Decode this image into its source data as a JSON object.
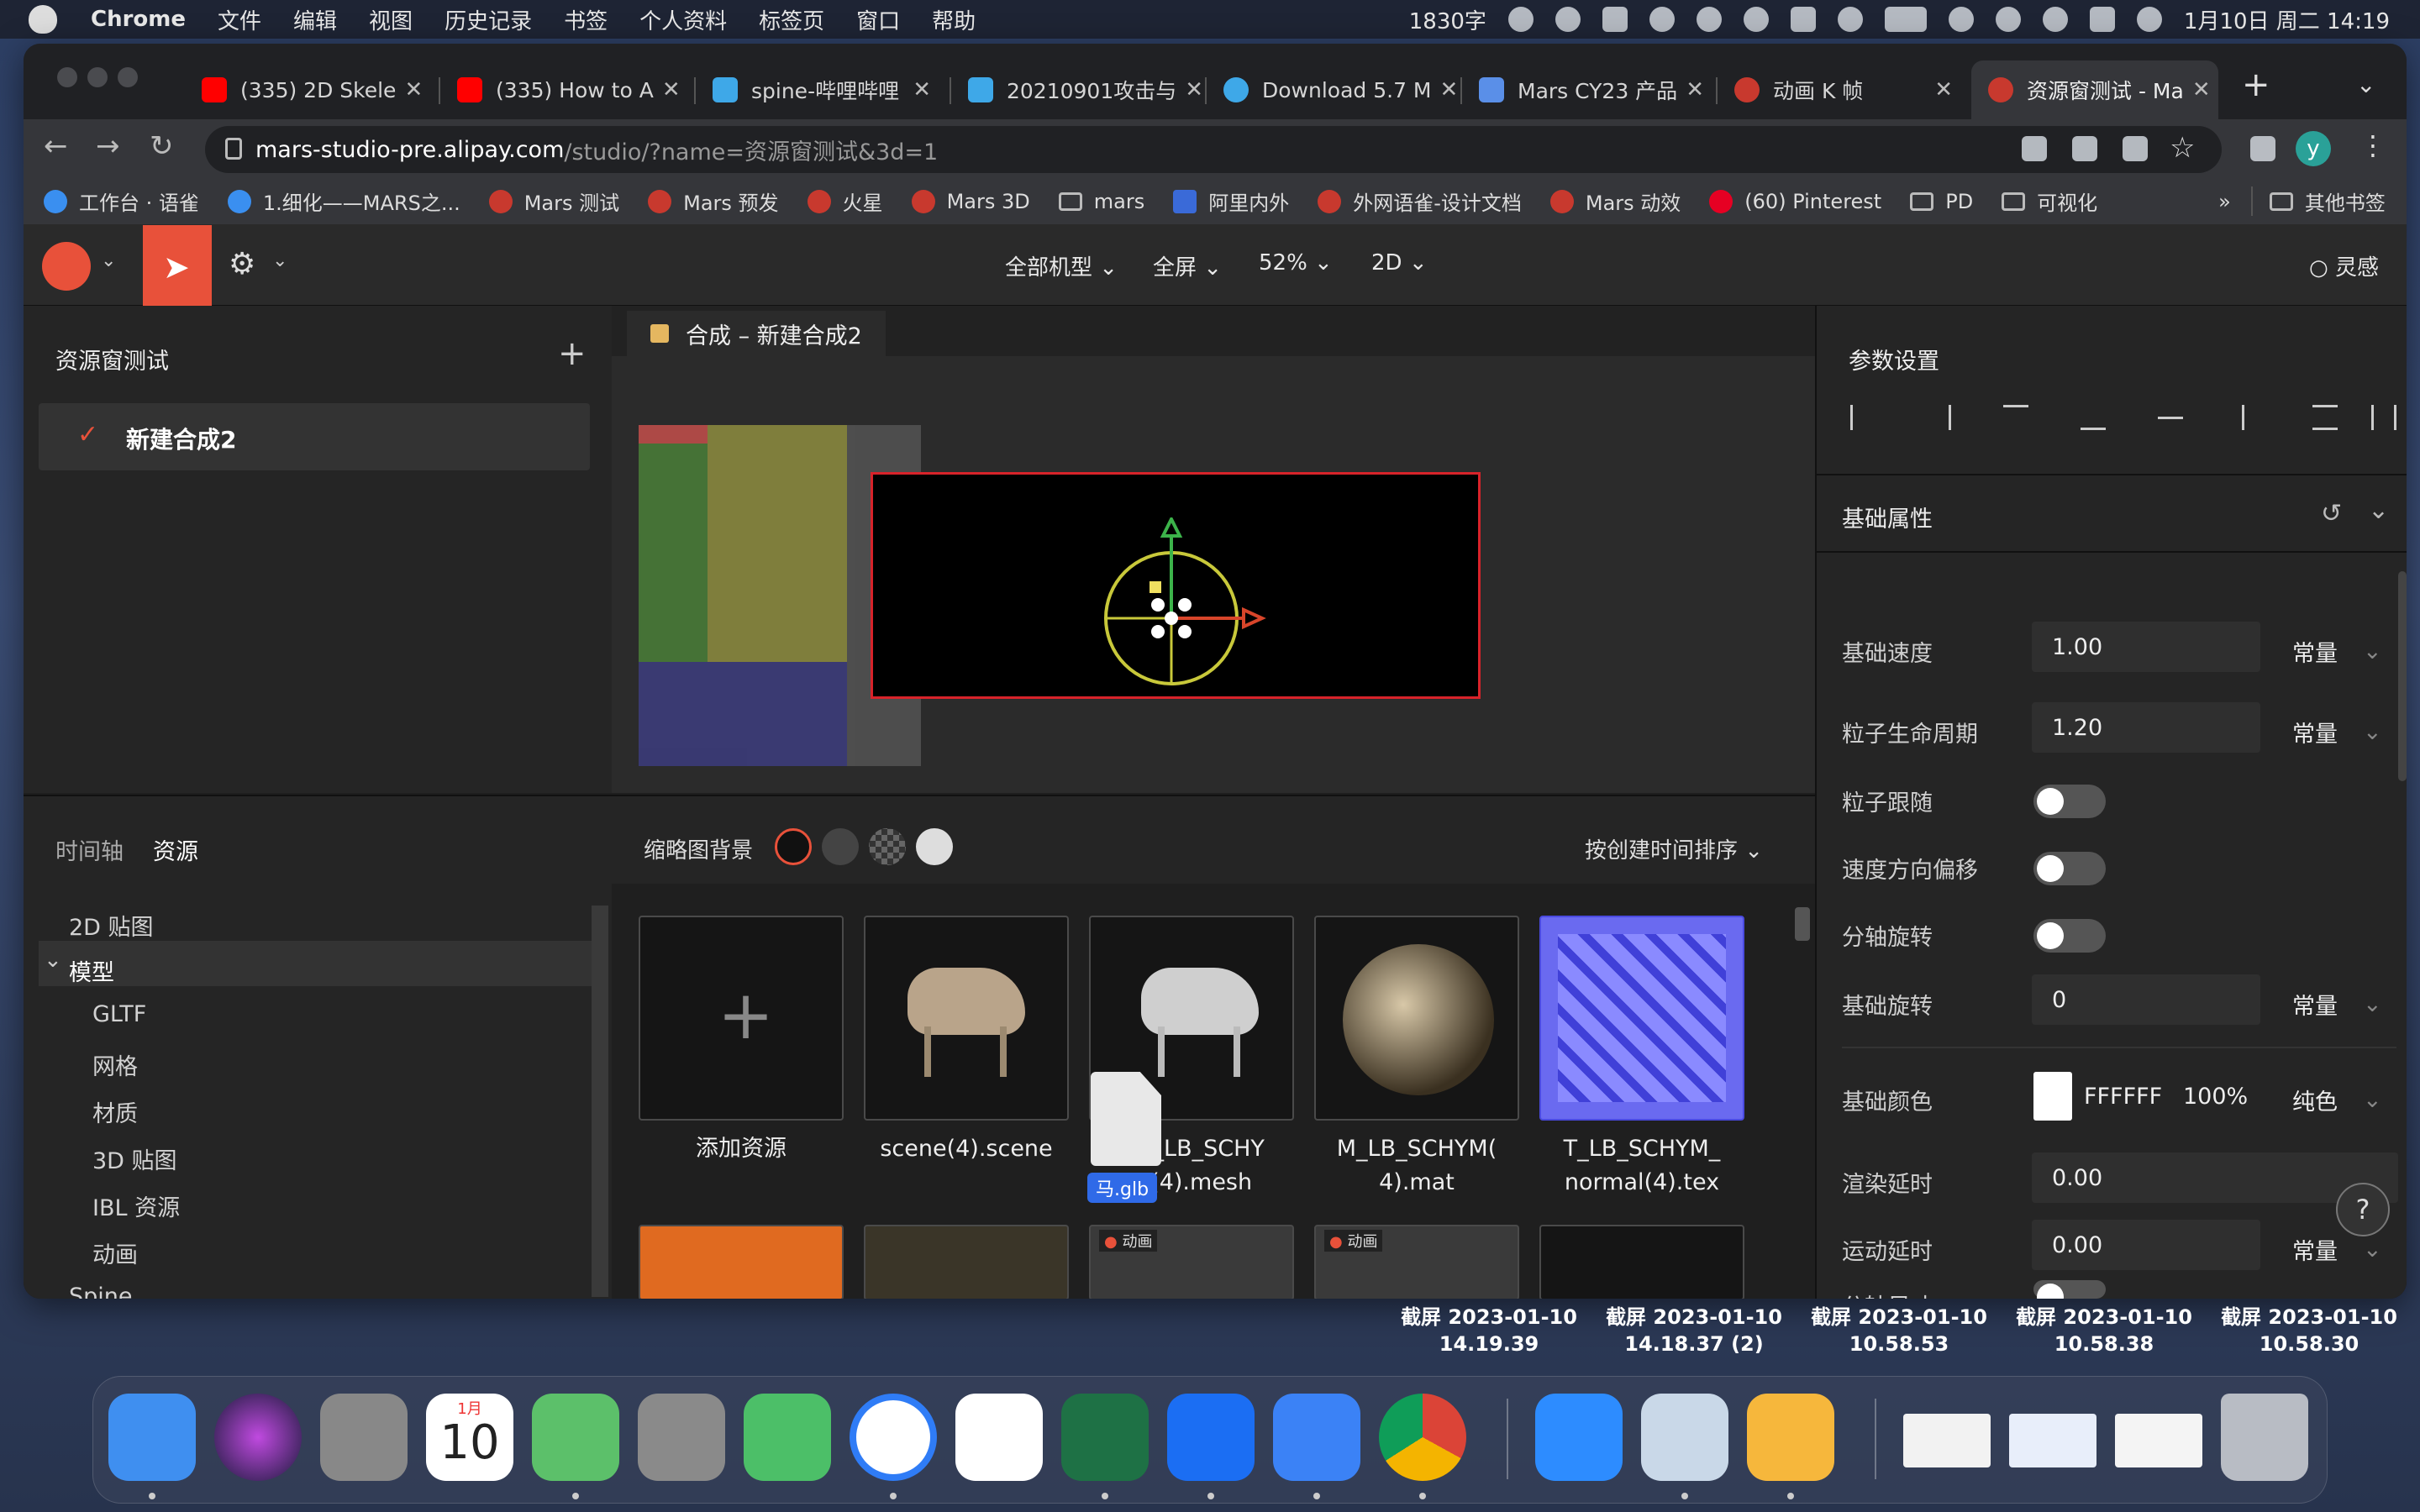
{
  "menubar": {
    "app": "Chrome",
    "items": [
      "文件",
      "编辑",
      "视图",
      "历史记录",
      "书签",
      "个人资料",
      "标签页",
      "窗口",
      "帮助"
    ],
    "word_count": "1830字",
    "datetime": "1月10日 周二  14:19"
  },
  "tabs": [
    {
      "label": "(335) 2D Skele",
      "color": "#ff0000"
    },
    {
      "label": "(335) How to A",
      "color": "#ff0000"
    },
    {
      "label": "spine-哔哩哔哩",
      "color": "#3ea8e8"
    },
    {
      "label": "20210901攻击与",
      "color": "#3ea8e8"
    },
    {
      "label": "Download 5.7 M",
      "color": "#3ea8e8"
    },
    {
      "label": "Mars CY23 产品",
      "color": "#5a8fe8"
    },
    {
      "label": "动画 K 帧",
      "color": "#c8392e"
    },
    {
      "label": "资源窗测试 - Ma",
      "color": "#c8392e",
      "active": true
    }
  ],
  "address": {
    "host": "mars-studio-pre.alipay.com",
    "path": "/studio/?name=资源窗测试&3d=1",
    "avatar": "y"
  },
  "bookmarks": [
    "工作台 · 语雀",
    "1.细化——MARS之...",
    "Mars 测试",
    "Mars 预发",
    "火星",
    "Mars 3D",
    "mars",
    "阿里内外",
    "外网语雀-设计文档",
    "Mars 动效",
    "(60) Pinterest",
    "PD",
    "可视化"
  ],
  "bookmarks_more": "»",
  "bookmarks_other": "其他书签",
  "toolbar": {
    "device": "全部机型",
    "screen": "全屏",
    "zoom": "52%",
    "mode": "2D",
    "inspiration": "灵感"
  },
  "left": {
    "title": "资源窗测试",
    "add": "+",
    "item": "新建合成2",
    "check": "✓"
  },
  "canvas": {
    "tab": "合成 – 新建合成2"
  },
  "bottom_left": {
    "tabs": [
      "时间轴",
      "资源"
    ],
    "tree": [
      "2D 贴图",
      "模型",
      "GLTF",
      "网格",
      "材质",
      "3D 贴图",
      "IBL 资源",
      "动画",
      "Spine"
    ]
  },
  "assets": {
    "bg_label": "缩略图背景",
    "sort": "按创建时间排序",
    "items": [
      {
        "label": "添加资源"
      },
      {
        "label": "scene(4).scene"
      },
      {
        "label": "MS_LB_SCHY M(4).mesh"
      },
      {
        "label": "M_LB_SCHYM( 4).mat"
      },
      {
        "label": "T_LB_SCHYM_ normal(4).tex"
      }
    ],
    "drag_file": "马.glb",
    "anim_tag": "动画"
  },
  "right": {
    "title": "参数设置",
    "section": "基础属性",
    "rows": [
      {
        "label": "基础速度",
        "value": "1.00",
        "mode": "常量"
      },
      {
        "label": "粒子生命周期",
        "value": "1.20",
        "mode": "常量"
      },
      {
        "label": "粒子跟随",
        "toggle": true
      },
      {
        "label": "速度方向偏移",
        "toggle": true
      },
      {
        "label": "分轴旋转",
        "toggle": true
      },
      {
        "label": "基础旋转",
        "value": "0",
        "mode": "常量"
      },
      {
        "label": "基础颜色",
        "value": "FFFFFF",
        "pct": "100%",
        "mode": "纯色"
      },
      {
        "label": "渲染延时",
        "value": "0.00"
      },
      {
        "label": "运动延时",
        "value": "0.00",
        "mode": "常量"
      },
      {
        "label": "分轴尺寸",
        "toggle": true
      }
    ],
    "help": "?"
  },
  "desktop_shots": [
    {
      "l1": "截屏 2023-01-10",
      "l2": "14.19.39"
    },
    {
      "l1": "截屏 2023-01-10",
      "l2": "14.18.37 (2)"
    },
    {
      "l1": "截屏 2023-01-10",
      "l2": "10.58.53"
    },
    {
      "l1": "截屏 2023-01-10",
      "l2": "10.58.38"
    },
    {
      "l1": "截屏 2023-01-10",
      "l2": "10.58.30"
    }
  ],
  "dock": {
    "calendar_month": "1月",
    "calendar_day": "10",
    "apps": [
      {
        "name": "finder-icon",
        "color": "#3f8ff0"
      },
      {
        "name": "siri-icon",
        "color": "#6a3ac8"
      },
      {
        "name": "launchpad-icon",
        "color": "#888"
      },
      {
        "name": "calendar-icon",
        "color": "#ffffff"
      },
      {
        "name": "maps-icon",
        "color": "#5cc06a"
      },
      {
        "name": "settings-icon",
        "color": "#8a8a8a"
      },
      {
        "name": "feishu-icon",
        "color": "#4cbf68"
      },
      {
        "name": "circle-app-icon",
        "color": "#2f7cf6"
      },
      {
        "name": "xmind-icon",
        "color": "#ffffff"
      },
      {
        "name": "excel-icon",
        "color": "#1e7145"
      },
      {
        "name": "shield-app-icon",
        "color": "#1b6ef3"
      },
      {
        "name": "dingtalk-icon",
        "color": "#3b82f6"
      },
      {
        "name": "chrome-icon",
        "color": "#e8e8e8"
      },
      {
        "name": "zoom-icon",
        "color": "#2d8cff"
      },
      {
        "name": "preview-icon",
        "color": "#c9d8e8"
      },
      {
        "name": "sketch-icon",
        "color": "#f6b73c"
      },
      {
        "name": "window-thumb-1",
        "color": "#f2f2f2"
      },
      {
        "name": "window-thumb-2",
        "color": "#e8eefa"
      },
      {
        "name": "window-thumb-3",
        "color": "#f4f4f4"
      },
      {
        "name": "trash-icon",
        "color": "#b8bcc4"
      }
    ]
  }
}
